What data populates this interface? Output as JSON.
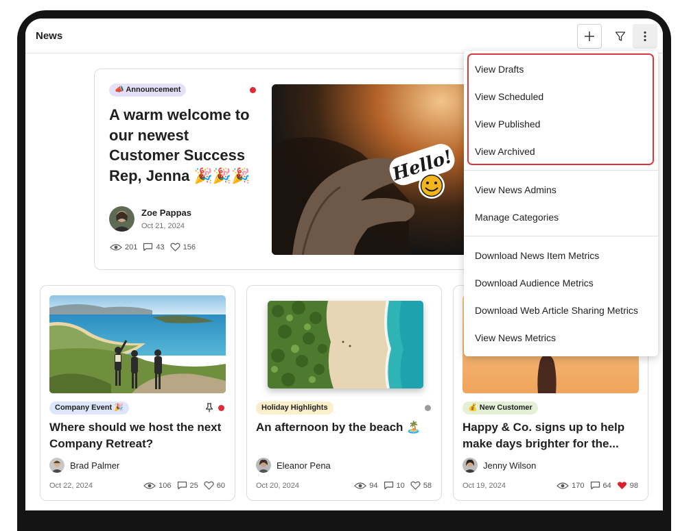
{
  "header": {
    "title": "News"
  },
  "featured": {
    "category": "📣 Announcement",
    "title": "A warm welcome to our newest Customer Success Rep, Jenna 🎉🎉🎉",
    "author": "Zoe Pappas",
    "date": "Oct 21, 2024",
    "views": "201",
    "comments": "43",
    "likes": "156",
    "image_text": "Hello!"
  },
  "cards": [
    {
      "category": "Company Event 🎉",
      "title": "Where should we host the next Company Retreat?",
      "author": "Brad Palmer",
      "date": "Oct 22, 2024",
      "views": "106",
      "comments": "25",
      "likes": "60"
    },
    {
      "category": "Holiday Highlights",
      "title": "An afternoon by the beach 🏝️",
      "author": "Eleanor Pena",
      "date": "Oct 20, 2024",
      "views": "94",
      "comments": "10",
      "likes": "58"
    },
    {
      "category": "💰 New Customer",
      "title": "Happy & Co. signs up to help make days brighter for the...",
      "author": "Jenny Wilson",
      "date": "Oct 19, 2024",
      "views": "170",
      "comments": "64",
      "likes": "98"
    }
  ],
  "menu": {
    "view_drafts": "View Drafts",
    "view_scheduled": "View Scheduled",
    "view_published": "View Published",
    "view_archived": "View Archived",
    "view_news_admins": "View News Admins",
    "manage_categories": "Manage Categories",
    "download_news_item_metrics": "Download News Item Metrics",
    "download_audience_metrics": "Download Audience Metrics",
    "download_web_article_sharing_metrics": "Download Web Article Sharing Metrics",
    "view_news_metrics": "View News Metrics"
  },
  "colors": {
    "unread_dot": "#e02b35",
    "read_dot": "#9a9a9a",
    "liked_heart": "#d8222b",
    "menu_highlight": "#d9383f"
  },
  "icons": [
    "plus-icon",
    "filter-icon",
    "more-vertical-icon",
    "eye-icon",
    "comment-icon",
    "heart-icon",
    "pin-icon"
  ]
}
